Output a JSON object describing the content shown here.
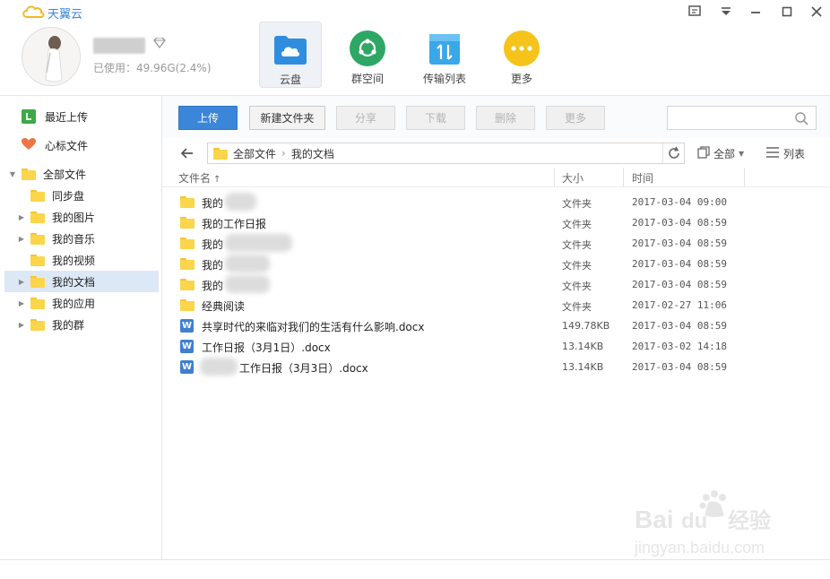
{
  "app": {
    "brand": "天翼云"
  },
  "user": {
    "usage": "已使用：49.96G(2.4%)"
  },
  "nav": [
    {
      "label": "云盘",
      "icon": "cloud-icon",
      "color": "#2f8de0"
    },
    {
      "label": "群空间",
      "icon": "group-icon",
      "color": "#2ea764"
    },
    {
      "label": "传输列表",
      "icon": "transfer-icon",
      "color": "#3aa7e8"
    },
    {
      "label": "更多",
      "icon": "more-icon",
      "color": "#f5c31a"
    }
  ],
  "sidebar": {
    "items": [
      {
        "label": "最近上传",
        "icon": "recent-upload-icon"
      },
      {
        "label": "心标文件",
        "icon": "heart-icon"
      },
      {
        "label": "全部文件",
        "icon": "folder-icon"
      },
      {
        "label": "同步盘",
        "icon": "folder-icon"
      },
      {
        "label": "我的图片",
        "icon": "folder-icon"
      },
      {
        "label": "我的音乐",
        "icon": "folder-icon"
      },
      {
        "label": "我的视频",
        "icon": "folder-icon"
      },
      {
        "label": "我的文档",
        "icon": "folder-icon",
        "selected": true
      },
      {
        "label": "我的应用",
        "icon": "folder-icon"
      },
      {
        "label": "我的群",
        "icon": "folder-icon"
      }
    ]
  },
  "toolbar": {
    "upload": "上传",
    "new_folder": "新建文件夹",
    "share": "分享",
    "download": "下载",
    "delete": "删除",
    "more": "更多",
    "search_placeholder": ""
  },
  "path": {
    "crumbs": [
      "全部文件",
      "我的文档"
    ],
    "filter": "全部",
    "view": "列表"
  },
  "columns": {
    "name": "文件名",
    "size": "大小",
    "time": "时间"
  },
  "files": [
    {
      "name": "我的",
      "type": "folder",
      "size": "文件夹",
      "time": "2017-03-04 09:00"
    },
    {
      "name": "我的工作日报",
      "type": "folder",
      "size": "文件夹",
      "time": "2017-03-04 08:59"
    },
    {
      "name": "我的",
      "type": "folder",
      "size": "文件夹",
      "time": "2017-03-04 08:59"
    },
    {
      "name": "我的",
      "type": "folder",
      "size": "文件夹",
      "time": "2017-03-04 08:59"
    },
    {
      "name": "我的",
      "type": "folder",
      "size": "文件夹",
      "time": "2017-03-04 08:59"
    },
    {
      "name": "经典阅读",
      "type": "folder",
      "size": "文件夹",
      "time": "2017-02-27 11:06"
    },
    {
      "name": "共享时代的来临对我们的生活有什么影响.docx",
      "type": "docx",
      "size": "149.78KB",
      "time": "2017-03-04 08:59"
    },
    {
      "name": "工作日报（3月1日）.docx",
      "type": "docx",
      "size": "13.14KB",
      "time": "2017-03-02 14:18"
    },
    {
      "name": "工作日报（3月3日）.docx",
      "type": "docx",
      "size": "13.14KB",
      "time": "2017-03-04 08:59"
    }
  ],
  "watermark": {
    "brand": "Bai du 经验",
    "url": "jingyan.baidu.com"
  }
}
